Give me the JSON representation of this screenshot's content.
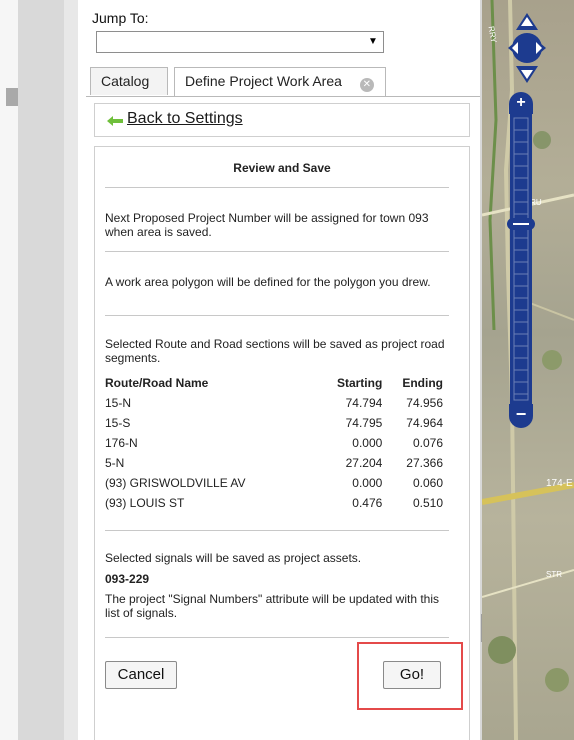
{
  "jump_to": {
    "label": "Jump To:",
    "selected": ""
  },
  "tabs": [
    {
      "label": "Catalog"
    },
    {
      "label": "Define Project Work Area"
    }
  ],
  "back_link": "Back to Settings",
  "review": {
    "title": "Review and Save",
    "project_number_text": "Next Proposed Project Number will be assigned for town 093 when area is saved.",
    "polygon_text": "A work area polygon will be defined for the polygon you drew.",
    "sections_text": "Selected Route and Road sections will be saved as project road segments.",
    "table": {
      "headers": [
        "Route/Road Name",
        "Starting",
        "Ending"
      ],
      "rows": [
        [
          "15-N",
          "74.794",
          "74.956"
        ],
        [
          "15-S",
          "74.795",
          "74.964"
        ],
        [
          "176-N",
          "0.000",
          "0.076"
        ],
        [
          "5-N",
          "27.204",
          "27.366"
        ],
        [
          "(93) GRISWOLDVILLE AV",
          "0.000",
          "0.060"
        ],
        [
          "(93) LOUIS ST",
          "0.476",
          "0.510"
        ]
      ]
    },
    "signals_text": "Selected signals will be saved as project assets.",
    "signal_id": "093-229",
    "signal_note": "The project \"Signal Numbers\" attribute will be updated with this list of signals.",
    "cancel_label": "Cancel",
    "go_label": "Go!"
  },
  "map": {
    "labels": [
      "ANT RU",
      "174-E",
      "STR",
      "RRY"
    ]
  }
}
